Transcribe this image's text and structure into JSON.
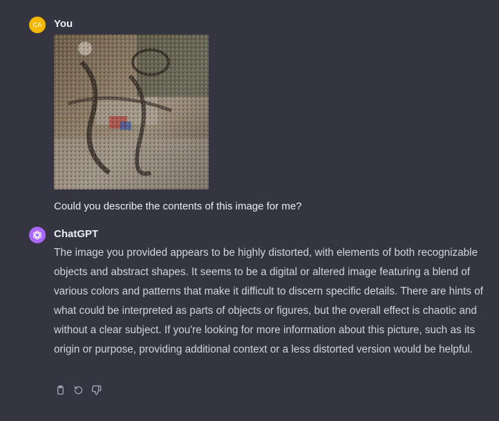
{
  "messages": {
    "user": {
      "author": "You",
      "initials": "CA",
      "avatar_color": "#f5b800",
      "text": "Could you describe the contents of this image for me?"
    },
    "assistant": {
      "author": "ChatGPT",
      "avatar_color": "#ab68ff",
      "avatar_icon": "openai-logo-icon",
      "text": "The image you provided appears to be highly distorted, with elements of both recognizable objects and abstract shapes. It seems to be a digital or altered image featuring a blend of various colors and patterns that make it difficult to discern specific details. There are hints of what could be interpreted as parts of objects or figures, but the overall effect is chaotic and without a clear subject. If you're looking for more information about this picture, such as its origin or purpose, providing additional context or a less distorted version would be helpful.",
      "actions": [
        "clipboard-icon",
        "regenerate-icon",
        "thumbs-down-icon"
      ]
    }
  },
  "theme": {
    "background": "#343541",
    "text": "#ececf1",
    "muted_text": "#d1d5db",
    "icon": "#acacbe"
  }
}
